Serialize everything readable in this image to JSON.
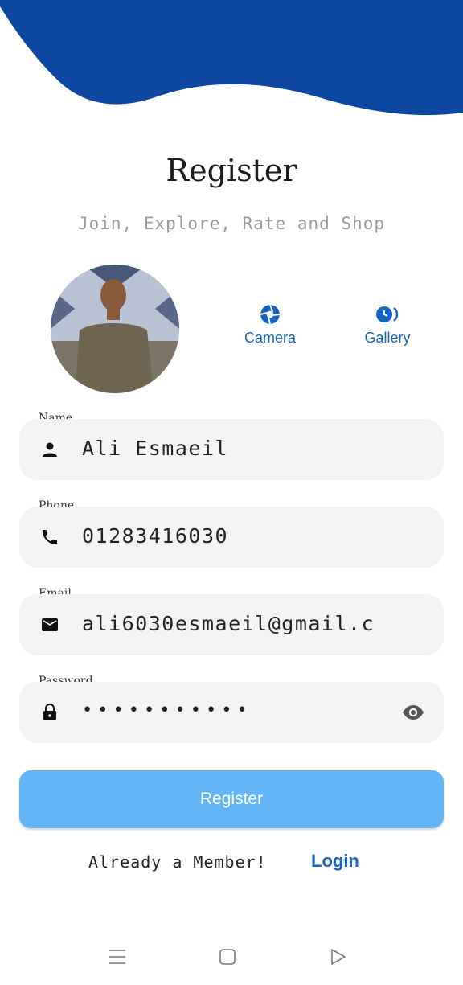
{
  "header": {
    "title": "Register",
    "subtitle": "Join, Explore, Rate and Shop",
    "wave_color": "#0d47a1"
  },
  "photo_picker": {
    "camera_label": "Camera",
    "gallery_label": "Gallery",
    "accent": "#1565c0"
  },
  "form": {
    "name": {
      "label": "Name",
      "value": "Ali Esmaeil",
      "icon": "person-icon"
    },
    "phone": {
      "label": "Phone",
      "value": "01283416030",
      "icon": "phone-icon"
    },
    "email": {
      "label": "Email",
      "value": "ali6030esmaeil@gmail.c",
      "icon": "mail-icon"
    },
    "password": {
      "label": "Password",
      "value": "•••••••••••",
      "icon": "lock-icon"
    }
  },
  "register_button": {
    "label": "Register",
    "color": "#64b5f6"
  },
  "footer": {
    "already_text": "Already a Member!",
    "login_label": "Login"
  },
  "nav": {
    "icons": [
      "menu-icon",
      "home-square-icon",
      "back-triangle-icon"
    ]
  }
}
